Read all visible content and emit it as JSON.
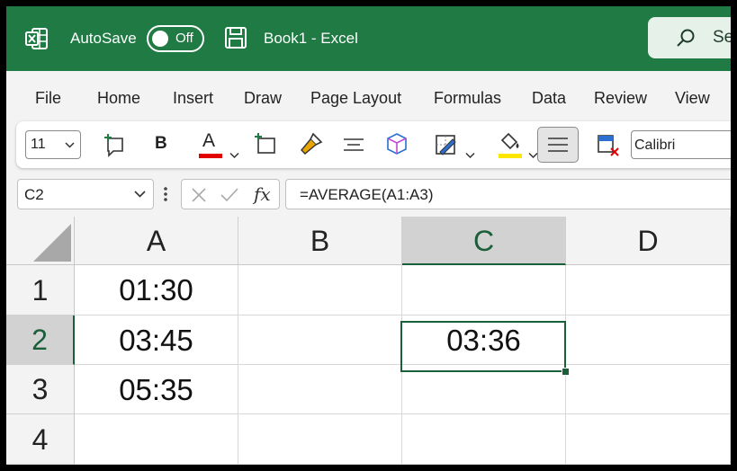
{
  "titlebar": {
    "autosave_label": "AutoSave",
    "autosave_state": "Off",
    "doc_title": "Book1  -  Excel",
    "search_text": "Se",
    "brand_color": "#1f7a43"
  },
  "menu": [
    "File",
    "Home",
    "Insert",
    "Draw",
    "Page Layout",
    "Formulas",
    "Data",
    "Review",
    "View"
  ],
  "ribbon": {
    "font_size": "11",
    "bold_label": "B",
    "font_color_label": "A",
    "font_name": "Calibri",
    "icons": [
      "new-comment-icon",
      "bold-icon",
      "font-color-icon",
      "insert-cells-icon",
      "format-painter-icon",
      "align-center-icon",
      "3d-model-icon",
      "borders-icon",
      "fill-color-icon",
      "align-justify-icon",
      "clear-format-icon"
    ]
  },
  "formula_bar": {
    "name_box": "C2",
    "formula": "=AVERAGE(A1:A3)",
    "fx_label": "fx"
  },
  "sheet": {
    "columns": [
      "A",
      "B",
      "C",
      "D"
    ],
    "rows": [
      "1",
      "2",
      "3",
      "4"
    ],
    "selected_cell": "C2",
    "cells": {
      "A1": "01:30",
      "A2": "03:45",
      "A3": "05:35",
      "C2": "03:36"
    }
  }
}
